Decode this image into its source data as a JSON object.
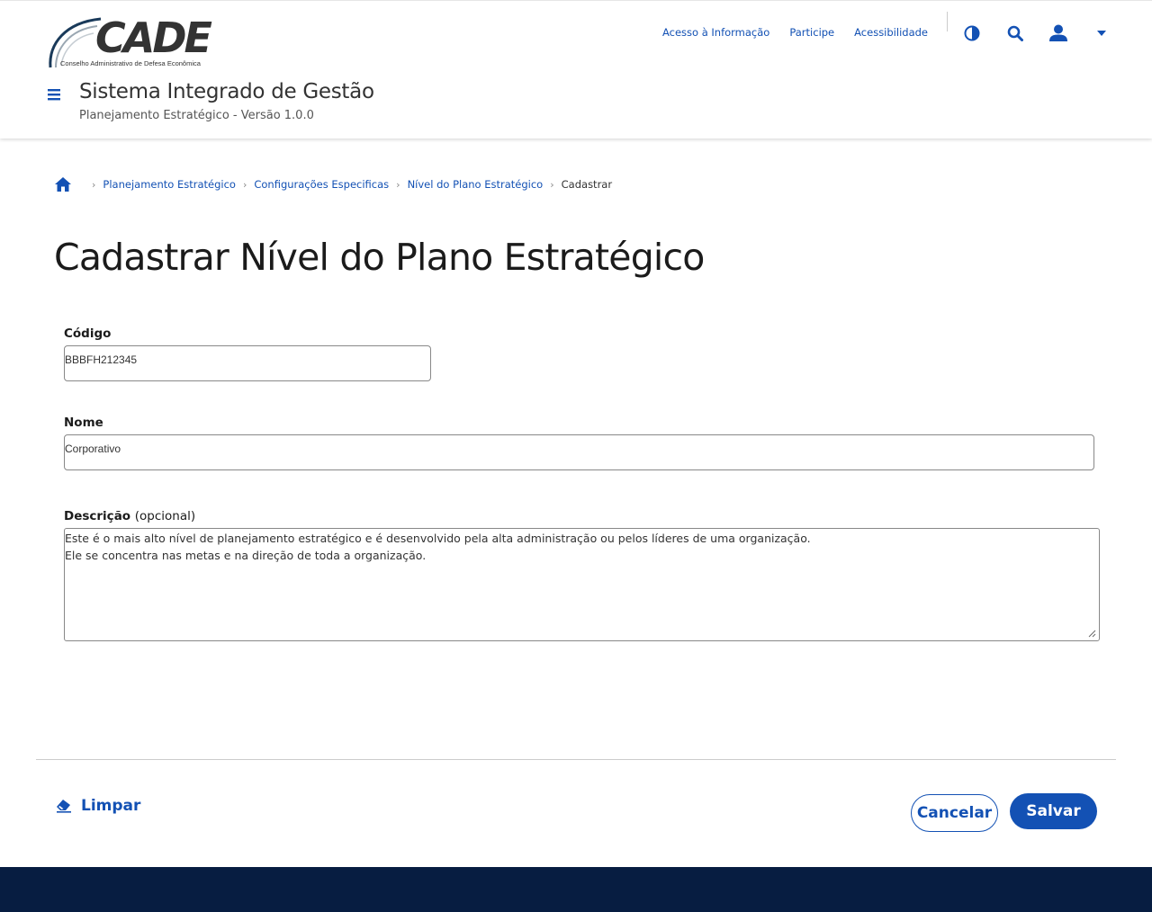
{
  "header": {
    "logo_text": "CADE",
    "logo_subtitle": "Conselho Administrativo de Defesa Econômica",
    "links": [
      "Acesso à Informação",
      "Participe",
      "Acessibilidade"
    ],
    "icons": [
      "contrast-icon",
      "search-icon",
      "user-icon",
      "caret-down-icon"
    ],
    "system_title": "Sistema Integrado de Gestão",
    "system_subtitle": "Planejamento Estratégico - Versão 1.0.0"
  },
  "breadcrumb": {
    "items": [
      "Planejamento Estratégico",
      "Configurações Especificas",
      "Nível do Plano Estratégico"
    ],
    "current": "Cadastrar"
  },
  "page": {
    "title": "Cadastrar Nível do Plano Estratégico"
  },
  "form": {
    "codigo": {
      "label": "Código",
      "value": "BBBFH212345"
    },
    "nome": {
      "label": "Nome",
      "value": "Corporativo"
    },
    "descricao": {
      "label": "Descrição",
      "optional": "(opcional)",
      "line1": "Este é o mais alto nível de planejamento estratégico e é desenvolvido pela alta administração ou pelos líderes de uma organização.",
      "line2": "Ele se concentra nas metas e na direção de toda a organização."
    }
  },
  "actions": {
    "clear_label": "Limpar",
    "cancel_label": "Cancelar",
    "save_label": "Salvar"
  },
  "colors": {
    "primary": "#1351b4",
    "footer": "#071d41",
    "text": "#1b1b1b"
  }
}
